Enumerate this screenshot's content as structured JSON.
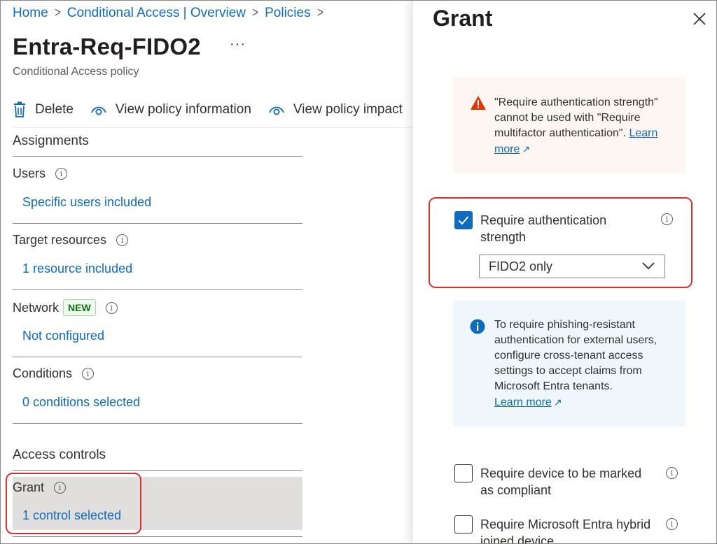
{
  "breadcrumb": {
    "items": [
      "Home",
      "Conditional Access | Overview",
      "Policies"
    ],
    "separator": ">"
  },
  "policy": {
    "title": "Entra-Req-FIDO2",
    "subtitle": "Conditional Access policy",
    "more": "···"
  },
  "toolbar": {
    "delete": "Delete",
    "view_info": "View policy information",
    "view_impact": "View policy impact"
  },
  "assignments": {
    "heading": "Assignments",
    "users": {
      "label": "Users",
      "value": "Specific users included"
    },
    "target_resources": {
      "label": "Target resources",
      "value": "1 resource included"
    },
    "network": {
      "label": "Network",
      "badge": "NEW",
      "value": "Not configured"
    },
    "conditions": {
      "label": "Conditions",
      "value": "0 conditions selected"
    }
  },
  "access_controls": {
    "heading": "Access controls",
    "grant": {
      "label": "Grant",
      "value": "1 control selected"
    }
  },
  "grant_panel": {
    "title": "Grant",
    "warning": {
      "text": "\"Require authentication strength\" cannot be used with \"Require multifactor authentication\".",
      "link": "Learn more"
    },
    "auth_strength": {
      "label": "Require authentication strength",
      "checked": true,
      "selected": "FIDO2 only"
    },
    "info": {
      "text": "To require phishing-resistant authentication for external users, configure cross-tenant access settings to accept claims from Microsoft Entra tenants.",
      "link": "Learn more"
    },
    "compliant": {
      "label": "Require device to be marked as compliant",
      "checked": false
    },
    "hybrid": {
      "label": "Require Microsoft Entra hybrid joined device",
      "checked": false
    }
  },
  "colors": {
    "link": "#0f6cbd",
    "highlight": "#d13438",
    "warning": "#d83b01",
    "selected_row": "#e1dfdd"
  },
  "icons": [
    "chevron-right-icon",
    "more-icon",
    "trash-icon",
    "eye-icon",
    "info-icon",
    "warning-icon",
    "external-link-icon",
    "close-icon",
    "checkmark-icon",
    "chevron-down-icon"
  ]
}
